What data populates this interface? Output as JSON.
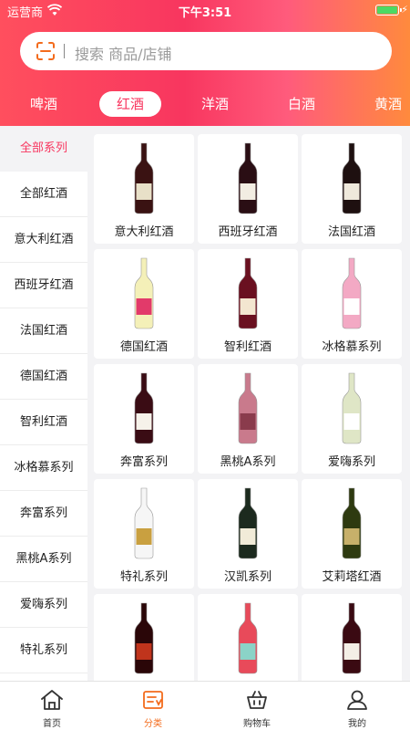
{
  "status_bar": {
    "carrier": "运营商",
    "time": "下午3:51"
  },
  "search": {
    "placeholder": "搜索 商品/店铺"
  },
  "category_tabs": [
    {
      "label": "啤酒",
      "active": false
    },
    {
      "label": "红酒",
      "active": true
    },
    {
      "label": "洋酒",
      "active": false
    },
    {
      "label": "白酒",
      "active": false
    },
    {
      "label": "黄酒",
      "active": false
    }
  ],
  "sidebar": {
    "items": [
      {
        "label": "全部系列",
        "active": true
      },
      {
        "label": "全部红酒"
      },
      {
        "label": "意大利红酒"
      },
      {
        "label": "西班牙红酒"
      },
      {
        "label": "法国红酒"
      },
      {
        "label": "德国红酒"
      },
      {
        "label": "智利红酒"
      },
      {
        "label": "冰格慕系列"
      },
      {
        "label": "奔富系列"
      },
      {
        "label": "黑桃A系列"
      },
      {
        "label": "爱嗨系列"
      },
      {
        "label": "特礼系列"
      }
    ]
  },
  "products": [
    {
      "label": "意大利红酒",
      "icon": "wine-bottle-icon",
      "color": "#3a1212",
      "label_color": "#e8e0c8"
    },
    {
      "label": "西班牙红酒",
      "icon": "wine-bottle-icon",
      "color": "#2a0e14",
      "label_color": "#f2ede2"
    },
    {
      "label": "法国红酒",
      "icon": "wine-bottle-icon",
      "color": "#1e1010",
      "label_color": "#efe9dc"
    },
    {
      "label": "德国红酒",
      "icon": "wine-bottle-icon",
      "color": "#f4f0b8",
      "label_color": "#e23a6a"
    },
    {
      "label": "智利红酒",
      "icon": "wine-bottle-icon",
      "color": "#6a1020",
      "label_color": "#f3e6d0"
    },
    {
      "label": "冰格慕系列",
      "icon": "wine-bottle-icon",
      "color": "#f3a9c4",
      "label_color": "#ffffff"
    },
    {
      "label": "奔富系列",
      "icon": "wine-bottle-icon",
      "color": "#3a0c14",
      "label_color": "#f6f2ea"
    },
    {
      "label": "黑桃A系列",
      "icon": "wine-bottle-icon",
      "color": "#c97a8c",
      "label_color": "#8a3b4c"
    },
    {
      "label": "爱嗨系列",
      "icon": "wine-bottle-icon",
      "color": "#dfe6c6",
      "label_color": "#ffffff"
    },
    {
      "label": "特礼系列",
      "icon": "wine-bottle-icon",
      "color": "#f6f6f6",
      "label_color": "#c9a040"
    },
    {
      "label": "汉凯系列",
      "icon": "wine-bottle-icon",
      "color": "#1c2a1e",
      "label_color": "#f1ebd8"
    },
    {
      "label": "艾莉塔红酒",
      "icon": "wine-bottle-icon",
      "color": "#2e3a10",
      "label_color": "#c7b06a"
    },
    {
      "label": "",
      "icon": "wine-bottle-icon",
      "color": "#2a0608",
      "label_color": "#c0341c"
    },
    {
      "label": "",
      "icon": "wine-bottle-icon",
      "color": "#e84a5a",
      "label_color": "#8bd3c7"
    },
    {
      "label": "",
      "icon": "wine-bottle-icon",
      "color": "#3a0a12",
      "label_color": "#f4efe6"
    }
  ],
  "tab_bar": [
    {
      "label": "首页",
      "icon": "home-icon",
      "active": false
    },
    {
      "label": "分类",
      "icon": "category-icon",
      "active": true
    },
    {
      "label": "购物车",
      "icon": "cart-icon",
      "active": false
    },
    {
      "label": "我的",
      "icon": "user-icon",
      "active": false
    }
  ],
  "colors": {
    "brand": "#f8365f",
    "active_tab": "#f36b1c",
    "background": "#f3f3f5"
  }
}
